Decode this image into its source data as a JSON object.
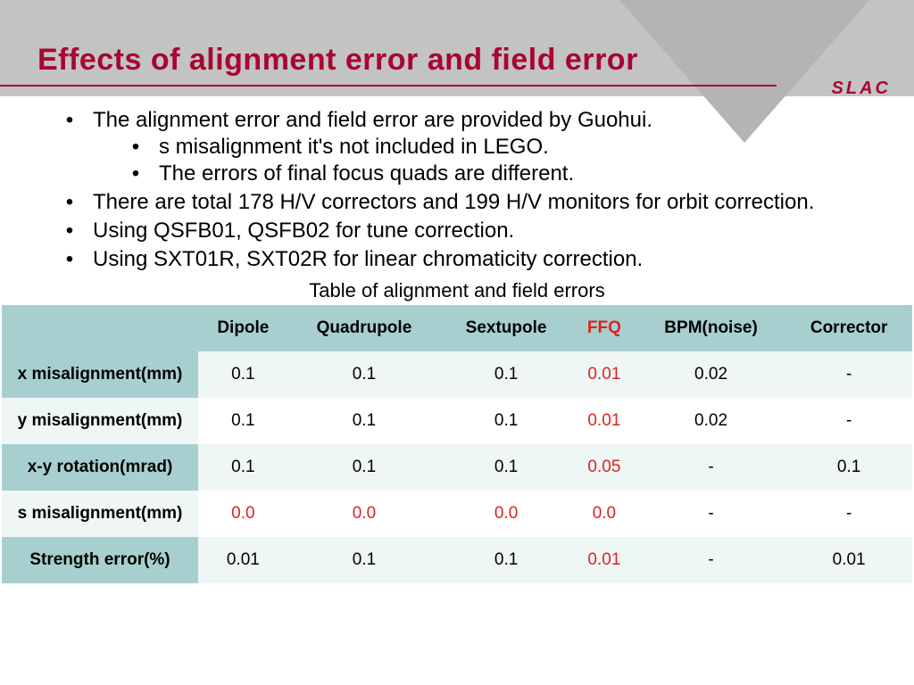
{
  "title": "Effects of alignment error and field error",
  "logo": "SLAC",
  "bullets": {
    "b1": "The alignment error and field error are provided by Guohui.",
    "b1a": "s misalignment it's not included in LEGO.",
    "b1b": "The errors of final focus quads are different.",
    "b2": "There are total 178 H/V correctors and 199 H/V monitors for orbit correction.",
    "b3": "Using QSFB01, QSFB02 for tune correction.",
    "b4": "Using SXT01R, SXT02R for linear chromaticity correction."
  },
  "table_caption": "Table of alignment and field errors",
  "chart_data": {
    "type": "table",
    "columns": [
      "Dipole",
      "Quadrupole",
      "Sextupole",
      "FFQ",
      "BPM(noise)",
      "Corrector"
    ],
    "highlight_column": "FFQ",
    "rows": [
      {
        "label": "x misalignment(mm)",
        "values": [
          "0.1",
          "0.1",
          "0.1",
          "0.01",
          "0.02",
          "-"
        ],
        "red_mask": [
          0,
          0,
          0,
          1,
          0,
          0
        ]
      },
      {
        "label": "y misalignment(mm)",
        "values": [
          "0.1",
          "0.1",
          "0.1",
          "0.01",
          "0.02",
          "-"
        ],
        "red_mask": [
          0,
          0,
          0,
          1,
          0,
          0
        ]
      },
      {
        "label": "x-y rotation(mrad)",
        "values": [
          "0.1",
          "0.1",
          "0.1",
          "0.05",
          "-",
          "0.1"
        ],
        "red_mask": [
          0,
          0,
          0,
          1,
          0,
          0
        ]
      },
      {
        "label": "s misalignment(mm)",
        "values": [
          "0.0",
          "0.0",
          "0.0",
          "0.0",
          "-",
          "-"
        ],
        "red_mask": [
          1,
          1,
          1,
          1,
          0,
          0
        ]
      },
      {
        "label": "Strength error(%)",
        "values": [
          "0.01",
          "0.1",
          "0.1",
          "0.01",
          "-",
          "0.01"
        ],
        "red_mask": [
          0,
          0,
          0,
          1,
          0,
          0
        ]
      }
    ]
  }
}
